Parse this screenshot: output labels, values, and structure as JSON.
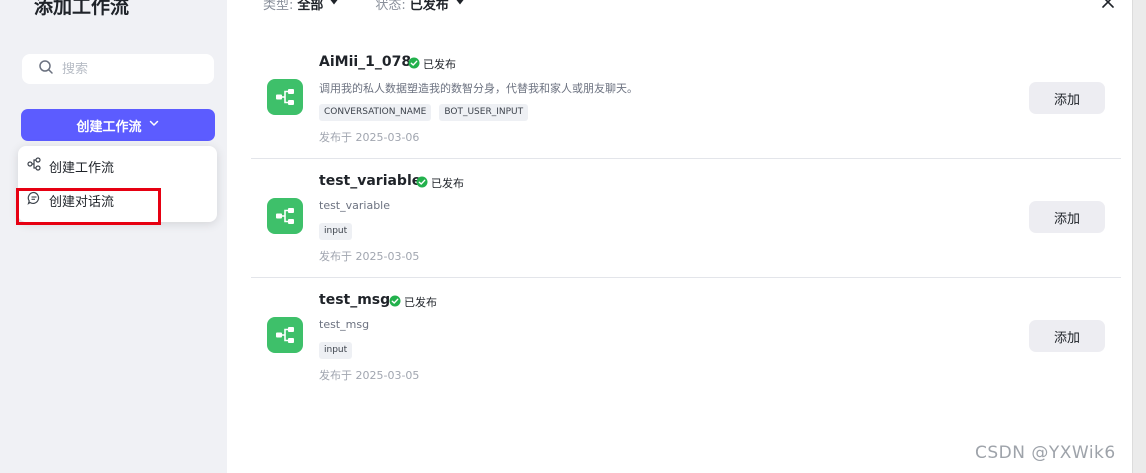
{
  "modal": {
    "title": "添加工作流"
  },
  "sidebar": {
    "search": {
      "placeholder": "搜索",
      "icon": "search-icon"
    },
    "create_button": {
      "label": "创建工作流",
      "icon": "chevron-down-icon"
    },
    "dropdown": [
      {
        "label": "创建工作流",
        "icon": "workflow-icon"
      },
      {
        "label": "创建对话流",
        "icon": "chat-bubble-icon"
      }
    ]
  },
  "filters": {
    "type": {
      "label": "类型:",
      "value": "全部"
    },
    "status": {
      "label": "状态:",
      "value": "已发布"
    }
  },
  "workflows": [
    {
      "name": "AiMii_1_078",
      "status": "已发布",
      "description": "调用我的私人数据塑造我的数智分身，代替我和家人或朋友聊天。",
      "tags": [
        "CONVERSATION_NAME",
        "BOT_USER_INPUT"
      ],
      "published": "发布于 2025-03-06",
      "add_label": "添加"
    },
    {
      "name": "test_variable",
      "status": "已发布",
      "description": "test_variable",
      "tags": [
        "input"
      ],
      "published": "发布于 2025-03-05",
      "add_label": "添加"
    },
    {
      "name": "test_msg",
      "status": "已发布",
      "description": "test_msg",
      "tags": [
        "input"
      ],
      "published": "发布于 2025-03-05",
      "add_label": "添加"
    }
  ],
  "colors": {
    "primary": "#5c5cff",
    "workflow_icon_bg": "#3ec06a",
    "status_green": "#22b14c",
    "highlight_red": "#e60012"
  },
  "watermark": "CSDN @YXWik6"
}
